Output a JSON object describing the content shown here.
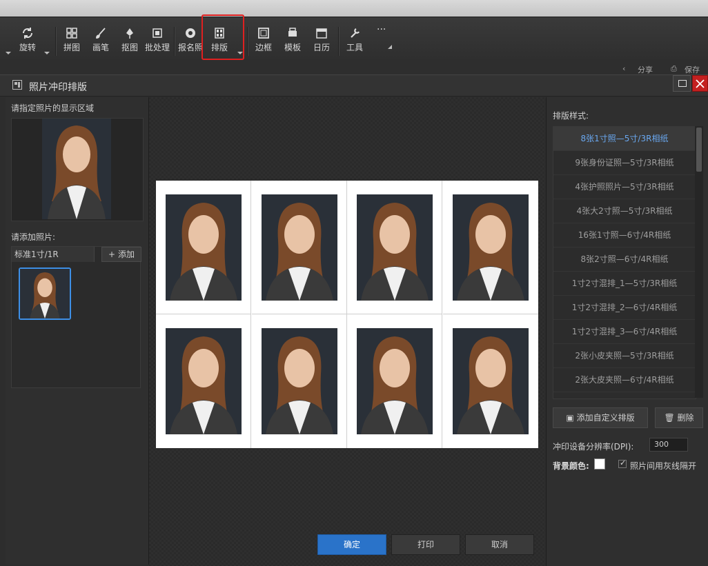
{
  "toolbar": {
    "items": [
      {
        "label": "旋转",
        "icon": "rotate-icon"
      },
      {
        "label": "拼图",
        "icon": "grid-icon"
      },
      {
        "label": "画笔",
        "icon": "brush-icon"
      },
      {
        "label": "抠图",
        "icon": "pen-icon"
      },
      {
        "label": "批处理",
        "icon": "batch-icon"
      },
      {
        "label": "报名照",
        "icon": "camera-icon"
      },
      {
        "label": "排版",
        "icon": "layout-icon"
      },
      {
        "label": "边框",
        "icon": "frame-icon"
      },
      {
        "label": "模板",
        "icon": "template-icon"
      },
      {
        "label": "日历",
        "icon": "calendar-icon"
      },
      {
        "label": "工具",
        "icon": "wrench-icon"
      }
    ],
    "more": "···"
  },
  "subbar": {
    "share": "分享",
    "save": "保存"
  },
  "dialog": {
    "title": "照片冲印排版",
    "left": {
      "display_area_label": "请指定照片的显示区域",
      "add_photo_label": "请添加照片:",
      "tab_label": "标准1寸/1R",
      "add_button": "添加"
    },
    "right": {
      "style_label": "排版样式:",
      "styles": [
        "8张1寸照—5寸/3R相纸",
        "9张身份证照—5寸/3R相纸",
        "4张护照照片—5寸/3R相纸",
        "4张大2寸照—5寸/3R相纸",
        "16张1寸照—6寸/4R相纸",
        "8张2寸照—6寸/4R相纸",
        "1寸2寸混排_1—5寸/3R相纸",
        "1寸2寸混排_2—6寸/4R相纸",
        "1寸2寸混排_3—6寸/4R相纸",
        "2张小皮夹照—5寸/3R相纸",
        "2张大皮夹照—6寸/4R相纸"
      ],
      "selected_index": 0,
      "add_custom_button": "添加自定义排版",
      "delete_button": "删除",
      "dpi_label": "冲印设备分辨率(DPI):",
      "dpi_value": "300",
      "bg_color_label": "背景颜色:",
      "bg_color": "#ffffff",
      "gray_line_label": "照片间用灰线隔开",
      "gray_line_checked": true
    },
    "buttons": {
      "ok": "确定",
      "print": "打印",
      "cancel": "取消"
    },
    "layout_rows": 2,
    "layout_cols": 4
  },
  "colors": {
    "accent": "#3d8fe6",
    "highlight": "#e02020",
    "ok_button": "#2a73c9",
    "close": "#c42020"
  }
}
